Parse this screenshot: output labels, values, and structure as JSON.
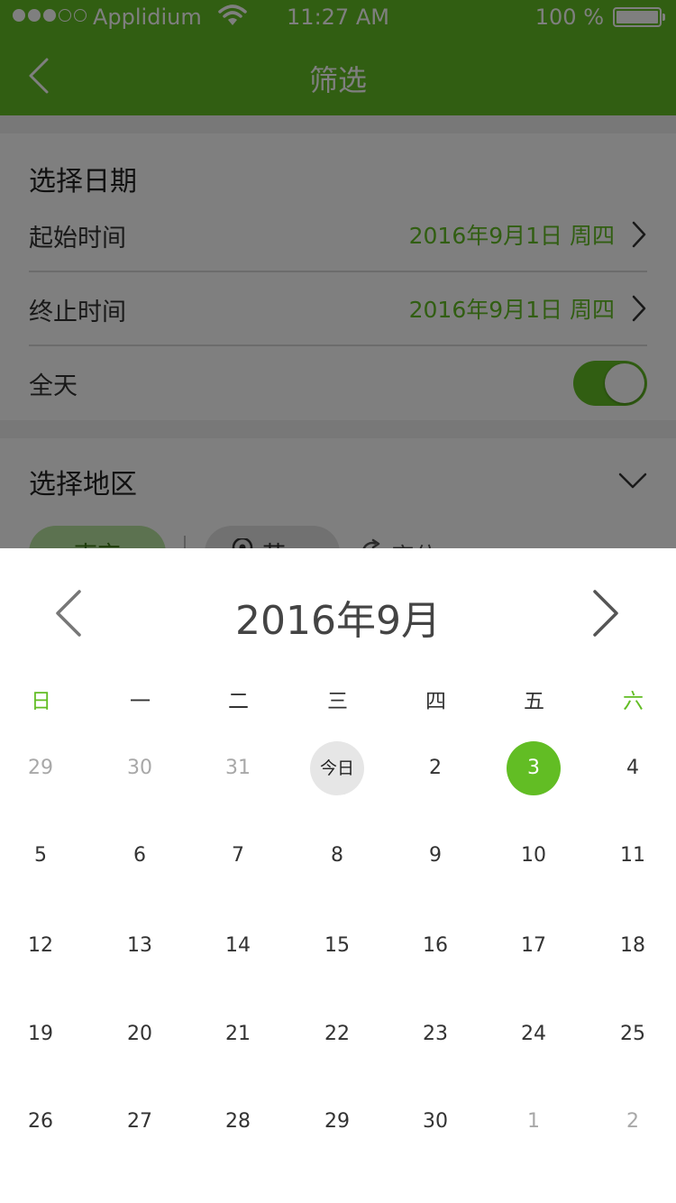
{
  "status_bar": {
    "carrier": "Applidium",
    "time": "11:27 AM",
    "battery": "100 %",
    "signal_dots_filled": 3,
    "signal_dots_total": 5
  },
  "nav": {
    "title": "筛选",
    "back_icon": "chevron-left-icon"
  },
  "date_section": {
    "title": "选择日期",
    "start_label": "起始时间",
    "start_value": "2016年9月1日  周四",
    "end_label": "终止时间",
    "end_value": "2016年9月1日  周四",
    "all_day_label": "全天",
    "all_day_on": true
  },
  "region_section": {
    "title": "选择地区",
    "chips": [
      "南京",
      "苏州"
    ],
    "locate_label": "定位"
  },
  "calendar": {
    "title": "2016年9月",
    "weekdays": [
      "日",
      "一",
      "二",
      "三",
      "四",
      "五",
      "六"
    ],
    "weeks": [
      [
        {
          "label": "29",
          "state": "muted"
        },
        {
          "label": "30",
          "state": "muted"
        },
        {
          "label": "31",
          "state": "muted"
        },
        {
          "label": "今日",
          "state": "today"
        },
        {
          "label": "2",
          "state": "normal"
        },
        {
          "label": "3",
          "state": "selected"
        },
        {
          "label": "4",
          "state": "normal"
        }
      ],
      [
        {
          "label": "5",
          "state": "normal"
        },
        {
          "label": "6",
          "state": "normal"
        },
        {
          "label": "7",
          "state": "normal"
        },
        {
          "label": "8",
          "state": "normal"
        },
        {
          "label": "9",
          "state": "normal"
        },
        {
          "label": "10",
          "state": "normal"
        },
        {
          "label": "11",
          "state": "normal"
        }
      ],
      [
        {
          "label": "12",
          "state": "normal"
        },
        {
          "label": "13",
          "state": "normal"
        },
        {
          "label": "14",
          "state": "normal"
        },
        {
          "label": "15",
          "state": "normal"
        },
        {
          "label": "16",
          "state": "normal"
        },
        {
          "label": "17",
          "state": "normal"
        },
        {
          "label": "18",
          "state": "normal"
        }
      ],
      [
        {
          "label": "19",
          "state": "normal"
        },
        {
          "label": "20",
          "state": "normal"
        },
        {
          "label": "21",
          "state": "normal"
        },
        {
          "label": "22",
          "state": "normal"
        },
        {
          "label": "23",
          "state": "normal"
        },
        {
          "label": "24",
          "state": "normal"
        },
        {
          "label": "25",
          "state": "normal"
        }
      ],
      [
        {
          "label": "26",
          "state": "normal"
        },
        {
          "label": "27",
          "state": "normal"
        },
        {
          "label": "28",
          "state": "normal"
        },
        {
          "label": "29",
          "state": "normal"
        },
        {
          "label": "30",
          "state": "normal"
        },
        {
          "label": "1",
          "state": "muted"
        },
        {
          "label": "2",
          "state": "muted"
        }
      ]
    ]
  },
  "colors": {
    "brand_green": "#62bd24",
    "muted_text": "#a8a8a8",
    "today_bg": "#e6e6e6"
  }
}
